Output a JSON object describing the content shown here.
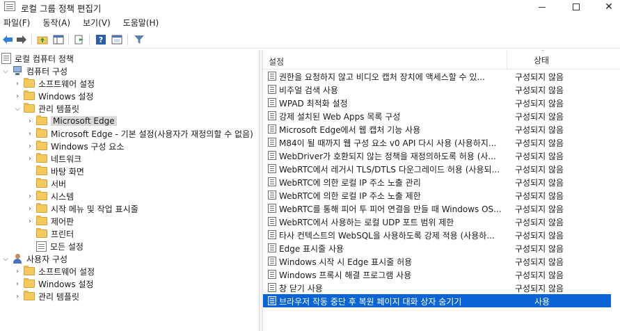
{
  "window": {
    "title": "로컬 그룹 정책 편집기"
  },
  "menu": [
    "파일(F)",
    "동작(A)",
    "보기(V)",
    "도움말(H)"
  ],
  "toolbar": {
    "icons": [
      "back-arrow-icon",
      "forward-arrow-icon",
      "up-folder-icon",
      "show-hide-tree-icon",
      "export-list-icon",
      "help-icon",
      "properties-icon",
      "filter-icon"
    ]
  },
  "tree": {
    "root": "로컬 컴퓨터 정책",
    "computer": "컴퓨터 구성",
    "computer_items": [
      "소프트웨어 설정",
      "Windows 설정",
      "관리 템플릿"
    ],
    "admin_items": [
      "Microsoft Edge",
      "Microsoft Edge - 기본 설정(사용자가 재정의할 수 없음)",
      "Windows 구성 요소",
      "네트워크",
      "바탕 화면",
      "서버",
      "시스템",
      "시작 메뉴 및 작업 표시줄",
      "제어판",
      "프린터",
      "모든 설정"
    ],
    "user": "사용자 구성",
    "user_items": [
      "소프트웨어 설정",
      "Windows 설정",
      "관리 템플릿"
    ]
  },
  "list": {
    "col_setting": "설정",
    "col_state": "상태",
    "rows": [
      {
        "name": "권한을 요청하지 않고 비디오 캡처 장치에 액세스할 수 있...",
        "state": "구성되지 않음"
      },
      {
        "name": "비주얼 검색 사용",
        "state": "구성되지 않음"
      },
      {
        "name": "WPAD 최적화 설정",
        "state": "구성되지 않음"
      },
      {
        "name": "강제 설치된 Web Apps 목록 구성",
        "state": "구성되지 않음"
      },
      {
        "name": "Microsoft Edge에서 웹 캡처 기능 사용",
        "state": "구성되지 않음"
      },
      {
        "name": "M84이 될 때까지 웹 구성 요소 v0 API 다시 사용 (사용하지...",
        "state": "구성되지 않음"
      },
      {
        "name": "WebDriver가 호환되지 않는 정책을 재정의하도록 허용 (사...",
        "state": "구성되지 않음"
      },
      {
        "name": "WebRTC에서 레거시 TLS/DTLS 다운그레이드 허용 (사용되...",
        "state": "구성되지 않음"
      },
      {
        "name": "WebRTC에 의한 로컬 IP 주소 노출 관리",
        "state": "구성되지 않음"
      },
      {
        "name": "WebRTC에 의한 로컬 IP 주소 노출 제한",
        "state": "구성되지 않음"
      },
      {
        "name": "WebRTC를 통해 피어 투 피어 연결을 만들 때 Windows OS...",
        "state": "구성되지 않음"
      },
      {
        "name": "WebRTC에서 사용하는 로컬 UDP 포트 범위 제한",
        "state": "구성되지 않음"
      },
      {
        "name": "타사 컨텍스트의 WebSQL을 사용하도록 강제 적용 (사용하...",
        "state": "구성되지 않음"
      },
      {
        "name": "Edge 표시줄 사용",
        "state": "구성되지 않음"
      },
      {
        "name": "Windows 시작 시 Edge 표시줄 허용",
        "state": "구성되지 않음"
      },
      {
        "name": "Windows 프록시 해결 프로그램 사용",
        "state": "구성되지 않음"
      },
      {
        "name": "창 닫기 사용",
        "state": "구성되지 않음"
      },
      {
        "name": "브라우저 작동 중단 후 복원 페이지 대화 상자 숨기기",
        "state": "사용"
      }
    ]
  },
  "colors": {
    "selection": "#0a64d6",
    "folder": "#f4c95d"
  }
}
